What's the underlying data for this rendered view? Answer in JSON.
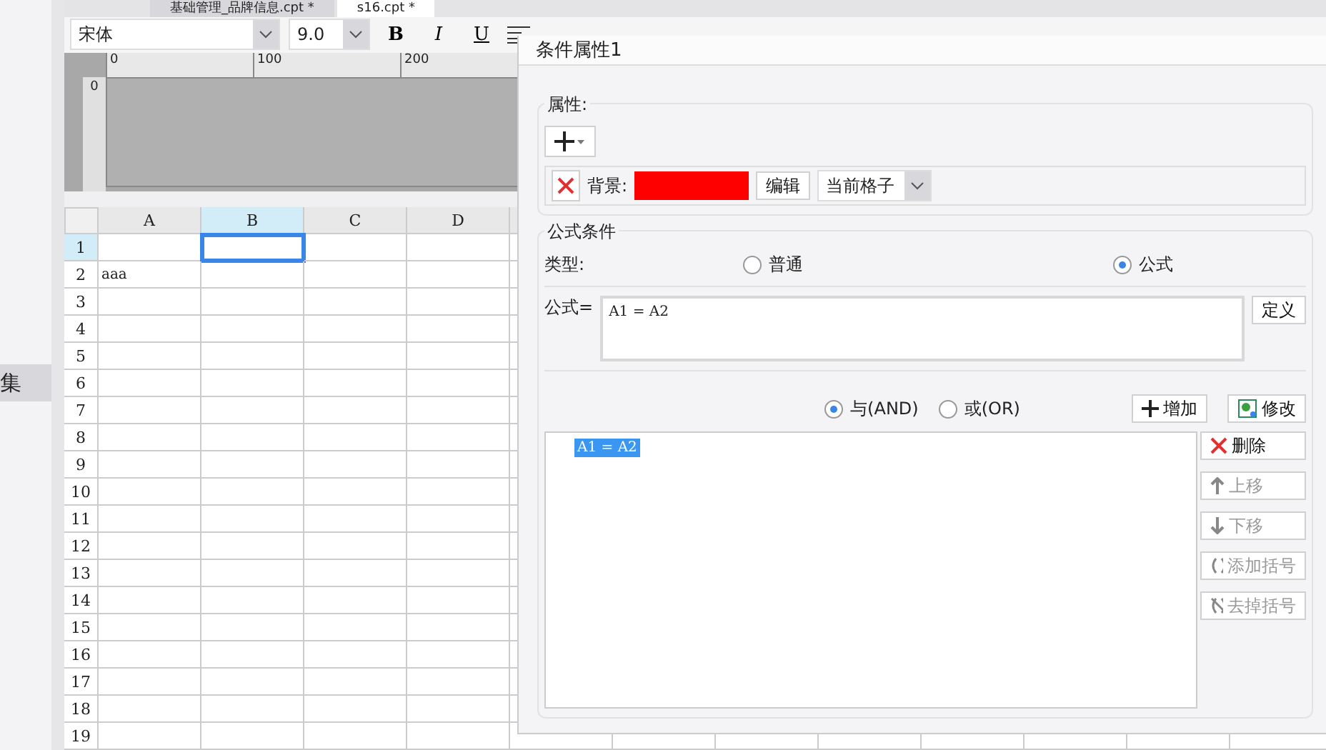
{
  "tabs": [
    {
      "label": "基础管理_品牌信息.cpt *",
      "selected": false
    },
    {
      "label": "s16.cpt *",
      "selected": true
    }
  ],
  "sidebar": {
    "items": [
      {
        "label": "集",
        "selected": true
      }
    ]
  },
  "toolbar": {
    "font": "宋体",
    "size": "9.0",
    "format_buttons": [
      {
        "label": "B",
        "kind": "bold",
        "on": false
      },
      {
        "label": "I",
        "kind": "italic",
        "on": false
      },
      {
        "label": "U",
        "kind": "underline",
        "on": false
      }
    ]
  },
  "ruler": {
    "ticks": [
      "0",
      "100",
      "200"
    ],
    "vertical_ticks": [
      "0"
    ]
  },
  "sheet": {
    "columns": [
      {
        "label": "A",
        "selected": false
      },
      {
        "label": "B",
        "selected": true
      },
      {
        "label": "C",
        "selected": false
      },
      {
        "label": "D",
        "selected": false
      }
    ],
    "rows": [
      {
        "label": "1",
        "selected": true
      },
      {
        "label": "2",
        "selected": false,
        "cells": [
          "aaa"
        ]
      },
      {
        "label": "3",
        "selected": false
      },
      {
        "label": "4",
        "selected": false
      },
      {
        "label": "5",
        "selected": false
      },
      {
        "label": "6",
        "selected": false
      },
      {
        "label": "7",
        "selected": false
      },
      {
        "label": "8",
        "selected": false
      },
      {
        "label": "9",
        "selected": false
      },
      {
        "label": "10",
        "selected": false
      },
      {
        "label": "11",
        "selected": false
      },
      {
        "label": "12",
        "selected": false
      },
      {
        "label": "13",
        "selected": false
      },
      {
        "label": "14",
        "selected": false
      },
      {
        "label": "15",
        "selected": false
      },
      {
        "label": "16",
        "selected": false
      },
      {
        "label": "17",
        "selected": false
      },
      {
        "label": "18",
        "selected": false
      },
      {
        "label": "19",
        "selected": false
      }
    ]
  },
  "dialog": {
    "title": "条件属性1",
    "properties": {
      "legend": "属性:",
      "background_label": "背景:",
      "edit_button": "编辑",
      "scope": "当前格子"
    },
    "formula_condition": {
      "legend": "公式条件",
      "type_label": "类型:",
      "types": [
        {
          "label": "普通",
          "selected": false
        },
        {
          "label": "公式",
          "selected": true
        }
      ],
      "formula_label": "公式=",
      "formula": "A1 = A2",
      "define_button": "定义",
      "logic": [
        {
          "label": "与(AND)",
          "selected": true
        },
        {
          "label": "或(OR)",
          "selected": false
        }
      ],
      "add_button": "增加",
      "modify_button": "修改",
      "conditions": [
        {
          "label": "A1 = A2",
          "selected": true
        }
      ],
      "actions": [
        {
          "label": "删除",
          "kind": "delete",
          "disabled": false
        },
        {
          "label": "上移",
          "kind": "up",
          "disabled": true
        },
        {
          "label": "下移",
          "kind": "down",
          "disabled": true
        },
        {
          "label": "添加括号",
          "kind": "add-paren",
          "disabled": true
        },
        {
          "label": "去掉括号",
          "kind": "remove-paren",
          "disabled": true
        }
      ]
    }
  }
}
